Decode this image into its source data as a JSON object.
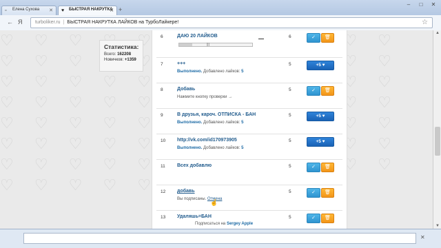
{
  "browser": {
    "tabs": [
      {
        "label": "Елена Сухова",
        "icon": "page-icon"
      },
      {
        "label": "БЫСТРАЯ НАКРУТКА",
        "icon": "heart-icon"
      }
    ],
    "address": {
      "url": "turboliker.ru",
      "page_title": "БЫСТРАЯ НАКРУТКА ЛАЙКОВ на ТурбоЛайкере!"
    },
    "window_buttons": [
      "–",
      "□",
      "✕"
    ]
  },
  "stats": {
    "title": "Статистика:",
    "total_label": "Всего:",
    "total_value": "162208",
    "new_label": "Новичков:",
    "new_value": "+1359"
  },
  "tasks": [
    {
      "num": "6",
      "title": "ДАЮ 20 ЛАЙКОВ",
      "count": "6",
      "type": "own",
      "progress": 0.18
    },
    {
      "num": "7",
      "title": "+++",
      "status": "Выполнено.",
      "added_label": "Добавлено лайков:",
      "added_value": "5",
      "count": "5",
      "type": "done",
      "like_label": "+5 ♥"
    },
    {
      "num": "8",
      "title": "Добавь",
      "sub": "Нажмите кнопку проверки →",
      "count": "5",
      "type": "own"
    },
    {
      "num": "9",
      "title": "В друзья, кароч. ОТПИСКА - БАН",
      "status": "Выполнено.",
      "added_label": "Добавлено лайков:",
      "added_value": "5",
      "count": "5",
      "type": "done",
      "like_label": "+5 ♥"
    },
    {
      "num": "10",
      "title": "http://vk.com/id170973905",
      "status": "Выполнено.",
      "added_label": "Добавлено лайков:",
      "added_value": "5",
      "count": "5",
      "type": "done",
      "like_label": "+5 ♥"
    },
    {
      "num": "11",
      "title": "Всех добавлю",
      "count": "5",
      "type": "own"
    },
    {
      "num": "12",
      "title": "добавь",
      "sub_prefix": "Вы подписаны.",
      "sub_link": "Отмена",
      "count": "5",
      "type": "own"
    },
    {
      "num": "13",
      "title": "Удаляшь=БАН",
      "sub_prefix": "Подписаться на",
      "sub_name": "Sergey Apple",
      "count": "5",
      "type": "own"
    }
  ],
  "icons": {
    "check": "✓",
    "delete": "🗑",
    "heart": "♥"
  },
  "colors": {
    "like_button": "#1a62b5",
    "check_button": "#2f94d0",
    "delete_button": "#f2951a",
    "link": "#1f5a8c"
  }
}
